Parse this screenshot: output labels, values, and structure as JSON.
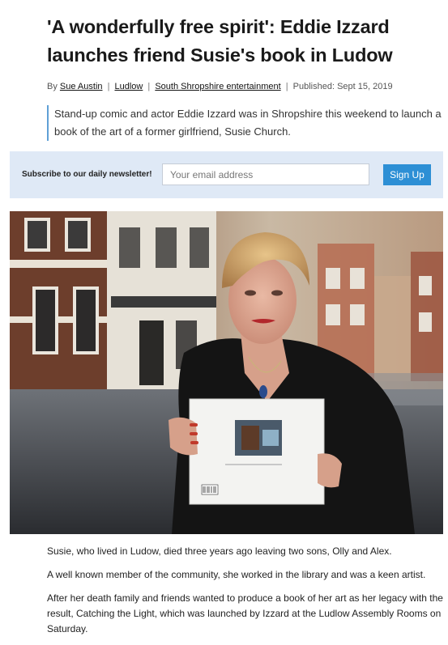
{
  "article": {
    "headline": "'A wonderfully free spirit': Eddie Izzard launches friend Susie's book in Ludow",
    "byline": {
      "by": "By",
      "author": "Sue Austin",
      "section1": "Ludlow",
      "section2": "South Shropshire entertainment",
      "separator": "|",
      "published": "Published: Sept 15, 2019"
    },
    "standfirst": "Stand-up comic and actor Eddie Izzard was in Shropshire this weekend to launch a book of the art of a former girlfriend, Susie Church.",
    "paragraphs": [
      "Susie, who lived in Ludow, died three years ago leaving two sons, Olly and Alex.",
      "A well known member of the community, she worked in the library and was a keen artist.",
      "After her death family and friends wanted to produce a book of her art as her legacy with the result, Catching the Light, which was launched by Izzard at the Ludlow Assembly Rooms on Saturday."
    ]
  },
  "newsletter": {
    "label": "Subscribe to our daily newsletter!",
    "placeholder": "Your email address",
    "button": "Sign Up"
  },
  "colors": {
    "accent": "#2d8fd5",
    "newsletter_bg": "#dfe9f6",
    "standfirst_rule": "#5fa0d6"
  }
}
